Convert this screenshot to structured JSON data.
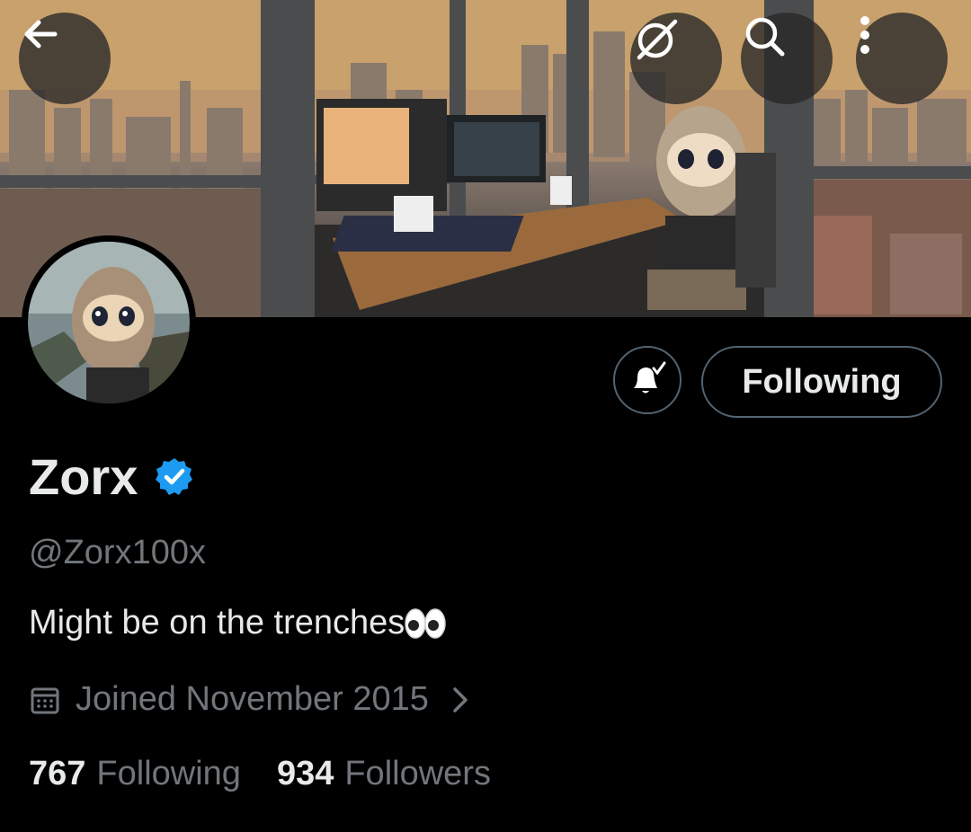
{
  "header": {
    "back_icon": "arrow-left-icon",
    "grok_icon": "grok-icon",
    "search_icon": "search-icon",
    "more_icon": "more-vertical-icon"
  },
  "profile": {
    "display_name": "Zorx",
    "verified": true,
    "handle": "@Zorx100x",
    "bio": "Might be on the trenches",
    "bio_emoji": "eyes-emoji",
    "joined": "Joined November 2015",
    "following_button": "Following",
    "following_count": "767",
    "following_label": "Following",
    "followers_count": "934",
    "followers_label": "Followers"
  },
  "colors": {
    "background": "#000000",
    "primary_text": "#e7e9ea",
    "secondary_text": "#71767b",
    "verified_blue": "#1d9bf0",
    "button_border": "#536471"
  }
}
